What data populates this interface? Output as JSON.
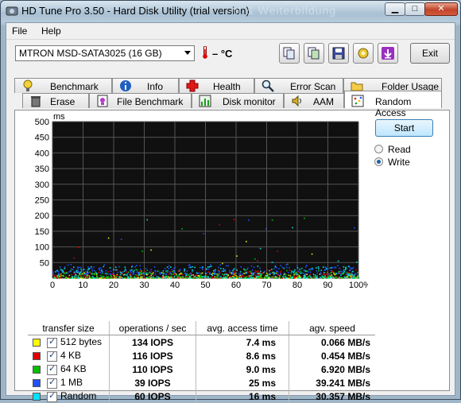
{
  "window": {
    "title": "HD Tune Pro 3.50 - Hard Disk Utility (trial version)",
    "bg_title": "nt & Weiterbildung"
  },
  "menu": {
    "file": "File",
    "help": "Help"
  },
  "toolbar": {
    "drive": "MTRON MSD-SATA3025 (16 GB)",
    "temperature": "– °C",
    "exit_label": "Exit"
  },
  "tabs_top": [
    {
      "label": "Benchmark",
      "icon": "lightbulb-icon"
    },
    {
      "label": "Info",
      "icon": "info-icon"
    },
    {
      "label": "Health",
      "icon": "health-cross-icon"
    },
    {
      "label": "Error Scan",
      "icon": "magnifier-icon"
    },
    {
      "label": "Folder Usage",
      "icon": "folder-icon"
    }
  ],
  "tabs_bottom": [
    {
      "label": "Erase",
      "icon": "trash-icon"
    },
    {
      "label": "File Benchmark",
      "icon": "file-benchmark-icon"
    },
    {
      "label": "Disk monitor",
      "icon": "disk-monitor-icon"
    },
    {
      "label": "AAM",
      "icon": "speaker-icon"
    },
    {
      "label": "Random Access",
      "icon": "random-access-icon",
      "active": true
    }
  ],
  "controls": {
    "start_label": "Start",
    "read_label": "Read",
    "write_label": "Write",
    "selected": "Write"
  },
  "chart_data": {
    "type": "scatter",
    "ylabel": "ms",
    "ylim": [
      0,
      500
    ],
    "y_ticks": [
      "500",
      "450",
      "400",
      "350",
      "300",
      "250",
      "200",
      "150",
      "100",
      "50"
    ],
    "xlim": [
      0,
      100
    ],
    "x_ticks": [
      "0",
      "10",
      "20",
      "30",
      "40",
      "50",
      "60",
      "70",
      "80",
      "90",
      "100%"
    ],
    "grid": true,
    "series": [
      {
        "name": "512 bytes",
        "color": "#e8e800",
        "approx_y_range_ms": [
          2,
          20
        ]
      },
      {
        "name": "4 KB",
        "color": "#e00000",
        "approx_y_range_ms": [
          2,
          30
        ]
      },
      {
        "name": "64 KB",
        "color": "#00c000",
        "approx_y_range_ms": [
          2,
          30
        ]
      },
      {
        "name": "1 MB",
        "color": "#2050ff",
        "approx_y_range_ms": [
          15,
          45
        ]
      },
      {
        "name": "Random",
        "color": "#00e0e0",
        "approx_y_range_ms": [
          2,
          40
        ]
      }
    ]
  },
  "stats": {
    "headers": [
      "transfer size",
      "operations / sec",
      "avg. access time",
      "agv. speed"
    ],
    "rows": [
      {
        "size": "512 bytes",
        "color": "#ffff00",
        "ops": "134 IOPS",
        "access": "7.4 ms",
        "speed": "0.066 MB/s"
      },
      {
        "size": "4 KB",
        "color": "#e00000",
        "ops": "116 IOPS",
        "access": "8.6 ms",
        "speed": "0.454 MB/s"
      },
      {
        "size": "64 KB",
        "color": "#00c000",
        "ops": "110 IOPS",
        "access": "9.0 ms",
        "speed": "6.920 MB/s"
      },
      {
        "size": "1 MB",
        "color": "#2050ff",
        "ops": "39 IOPS",
        "access": "25 ms",
        "speed": "39.241 MB/s"
      },
      {
        "size": "Random",
        "color": "#00e0ff",
        "ops": "60 IOPS",
        "access": "16 ms",
        "speed": "30.357 MB/s"
      }
    ]
  }
}
